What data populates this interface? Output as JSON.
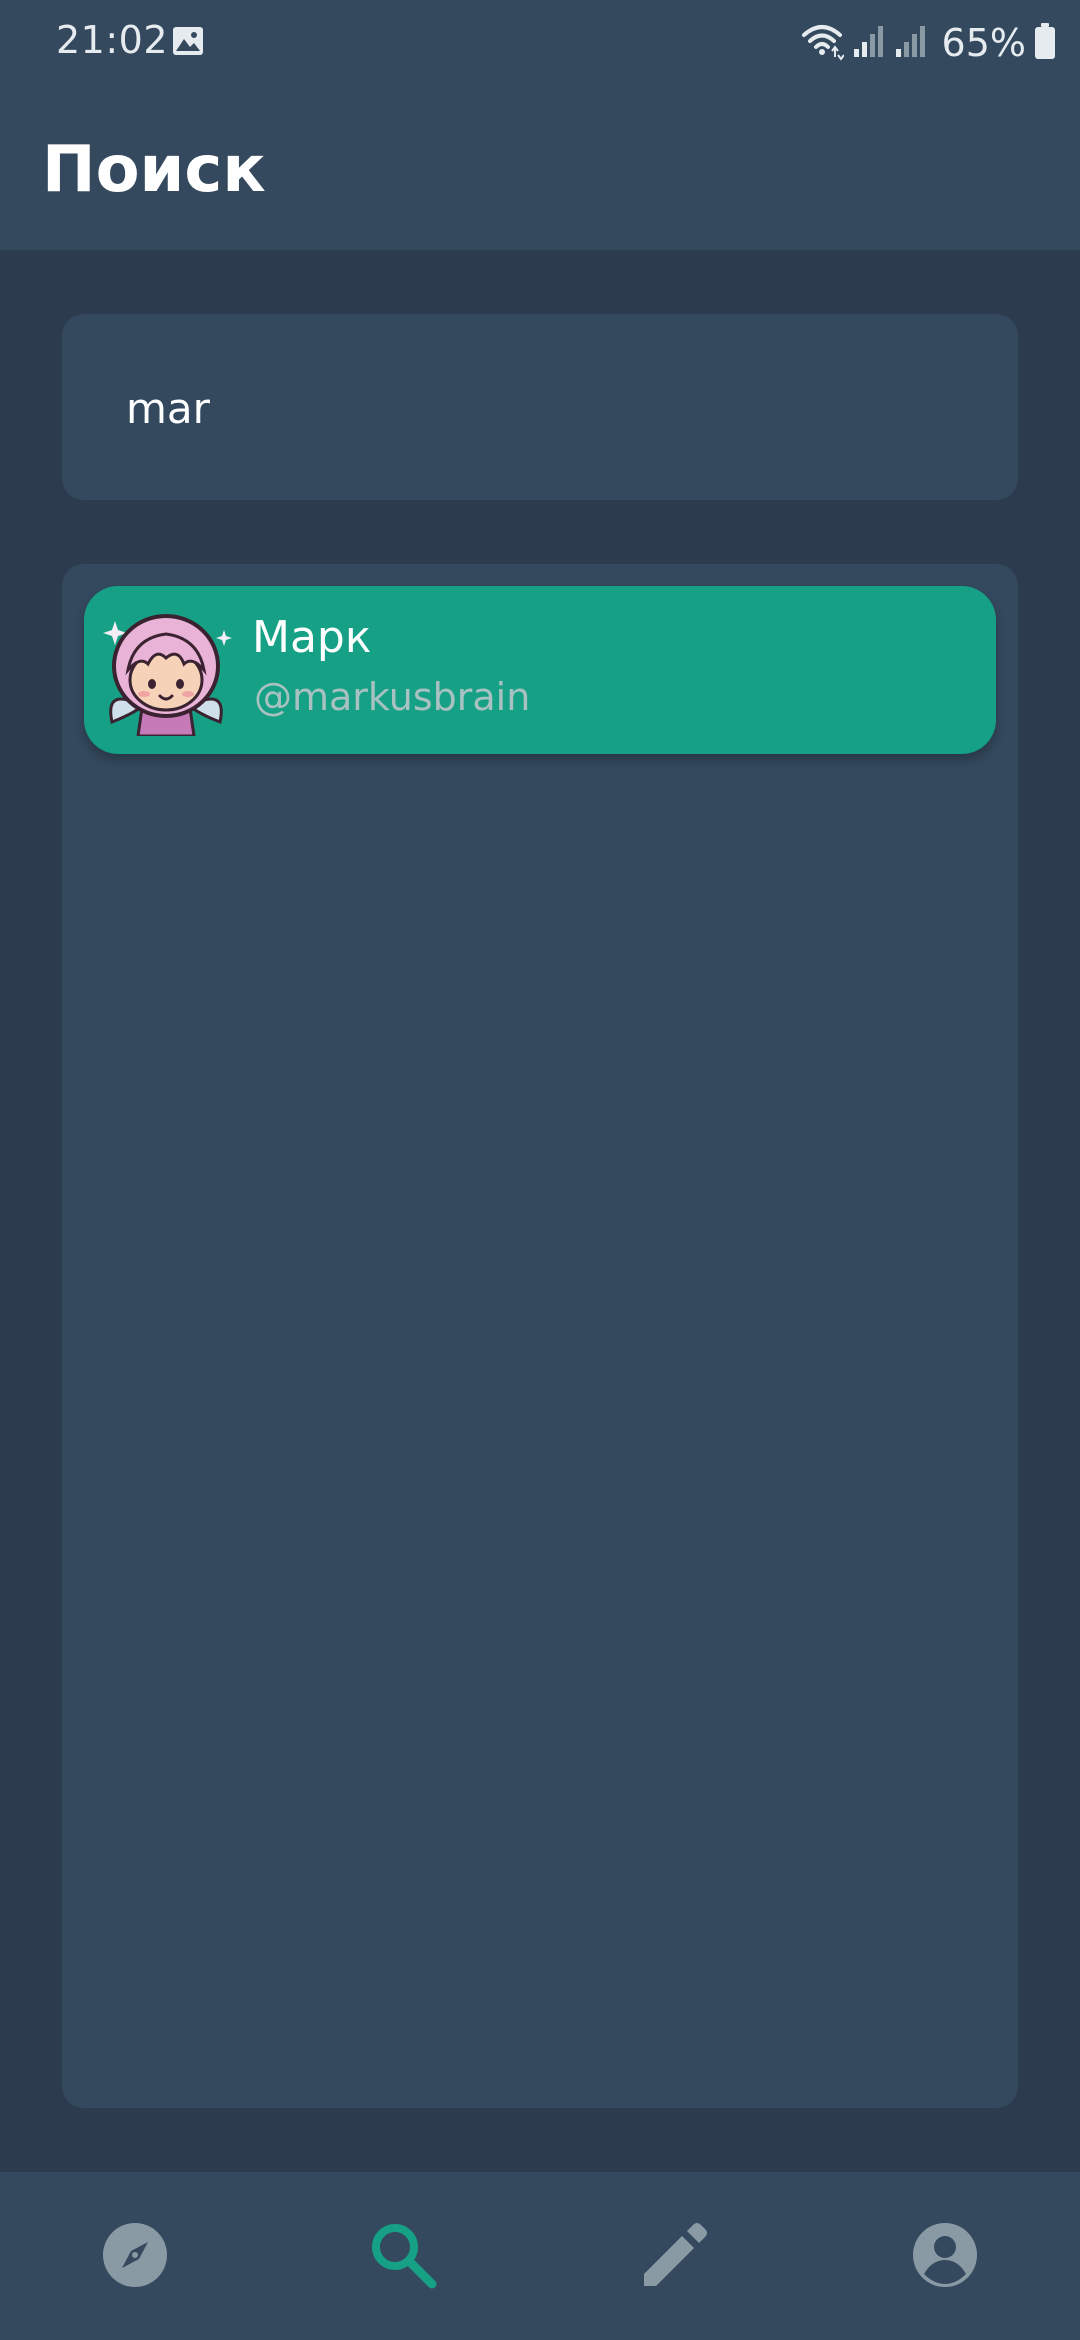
{
  "status_bar": {
    "time": "21:02",
    "battery": "65%",
    "icons": [
      "gallery-icon",
      "wifi-icon",
      "signal-icon",
      "signal-icon",
      "battery-icon"
    ]
  },
  "header": {
    "title": "Поиск"
  },
  "search": {
    "value": "mar",
    "placeholder": ""
  },
  "results": [
    {
      "name": "Марк",
      "handle": "@markusbrain",
      "avatar": "fairy-avatar"
    }
  ],
  "bottom_nav": {
    "items": [
      {
        "icon": "compass-icon",
        "active": false
      },
      {
        "icon": "search-icon",
        "active": true
      },
      {
        "icon": "pencil-icon",
        "active": false
      },
      {
        "icon": "account-icon",
        "active": false
      }
    ]
  },
  "colors": {
    "background": "#2d3b4e",
    "surface": "#34495e",
    "accent": "#16a085",
    "icon_inactive": "#8a9aa5",
    "handle_text": "#a8c1c1"
  }
}
